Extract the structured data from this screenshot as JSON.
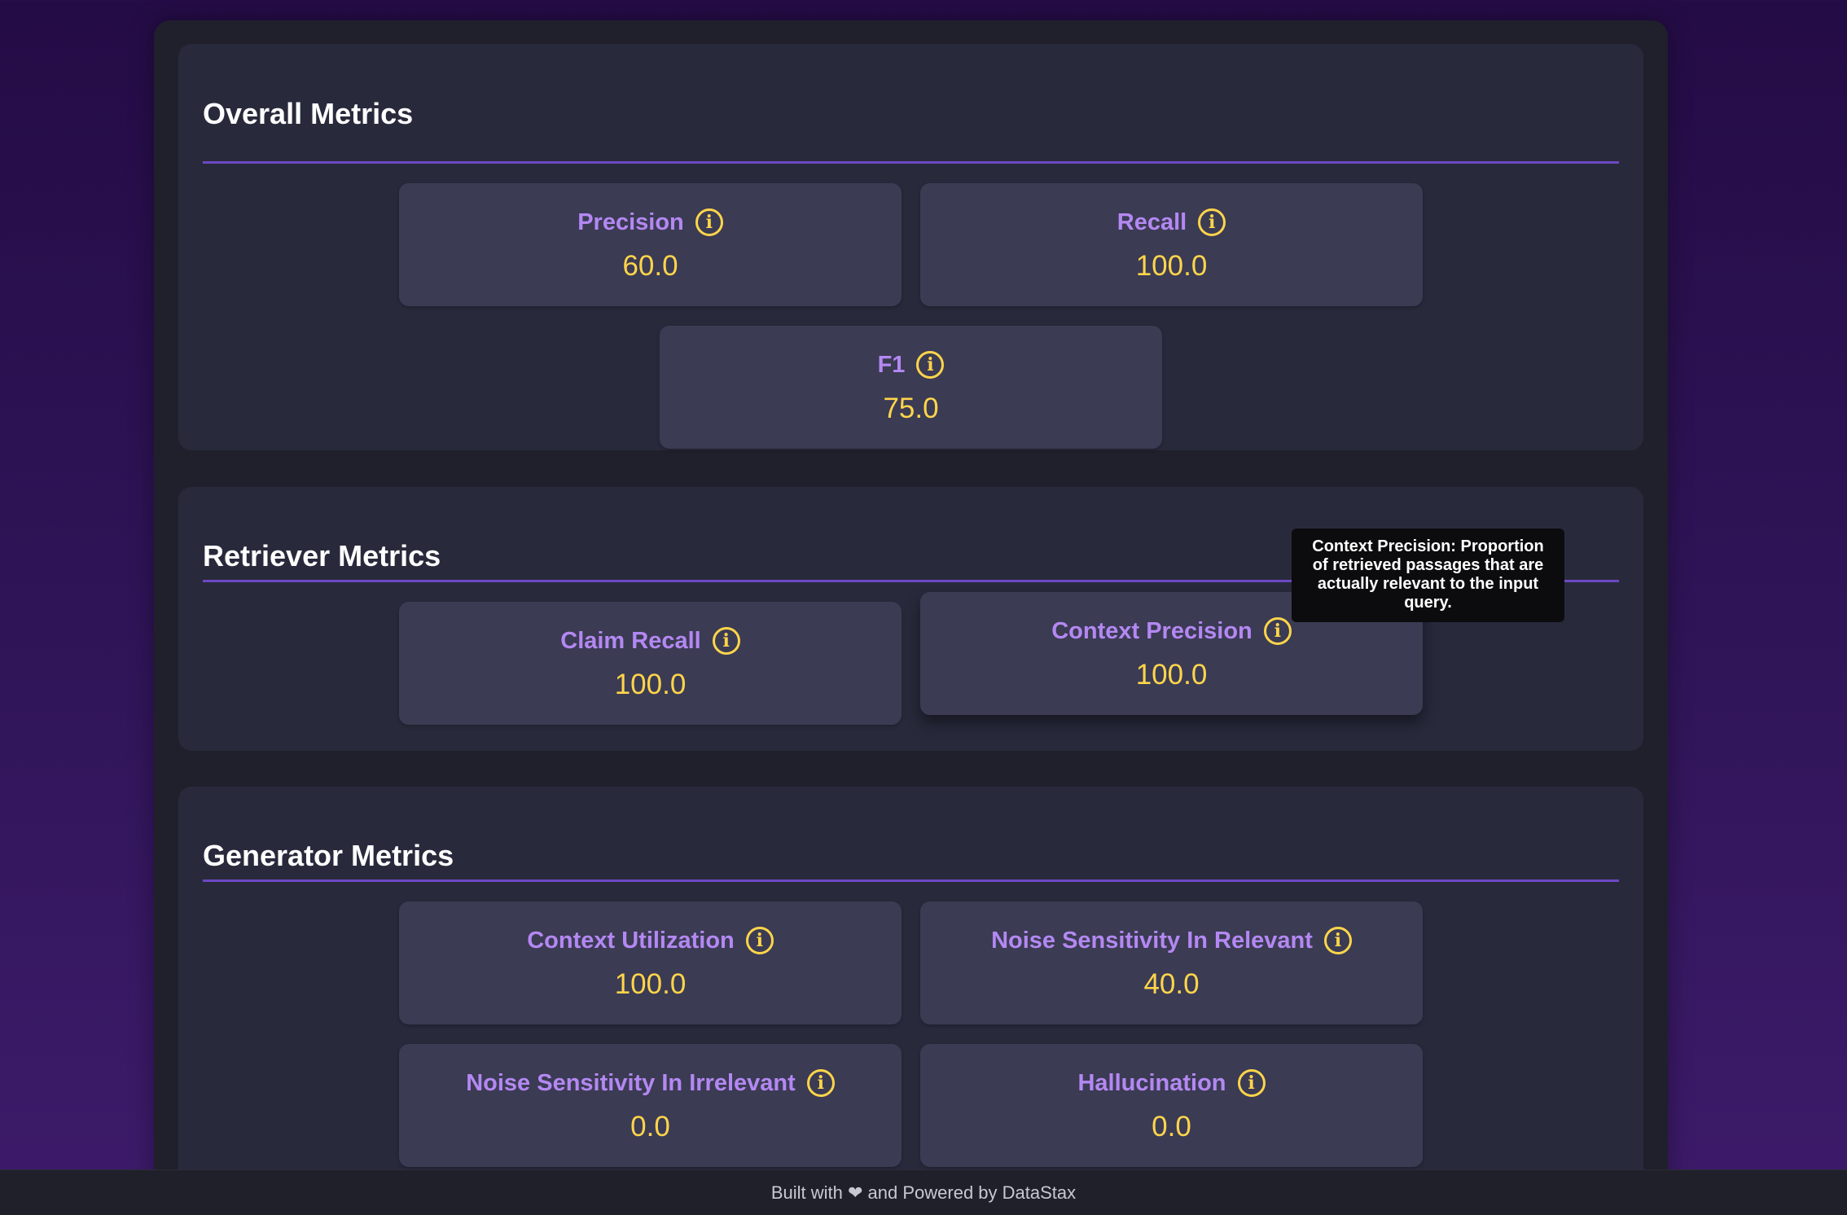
{
  "sections": {
    "overall": {
      "title": "Overall Metrics",
      "cards": [
        {
          "label": "Precision",
          "value": "60.0"
        },
        {
          "label": "Recall",
          "value": "100.0"
        },
        {
          "label": "F1",
          "value": "75.0"
        }
      ]
    },
    "retriever": {
      "title": "Retriever Metrics",
      "cards": [
        {
          "label": "Claim Recall",
          "value": "100.0"
        },
        {
          "label": "Context Precision",
          "value": "100.0"
        }
      ]
    },
    "generator": {
      "title": "Generator Metrics",
      "cards": [
        {
          "label": "Context Utilization",
          "value": "100.0"
        },
        {
          "label": "Noise Sensitivity In Relevant",
          "value": "40.0"
        },
        {
          "label": "Noise Sensitivity In Irrelevant",
          "value": "0.0"
        },
        {
          "label": "Hallucination",
          "value": "0.0"
        }
      ]
    }
  },
  "info_icon_glyph": "i",
  "tooltip": {
    "text": "Context Precision: Proportion of retrieved passages that are actually relevant to the input query."
  },
  "footer": {
    "text": "Built with ❤ and Powered by DataStax"
  },
  "colors": {
    "metric_label": "#b488f2",
    "metric_value": "#ffd54a",
    "accent_rule": "#6d48c2",
    "card_bg": "#3b3b54",
    "section_bg": "#282a3c"
  }
}
